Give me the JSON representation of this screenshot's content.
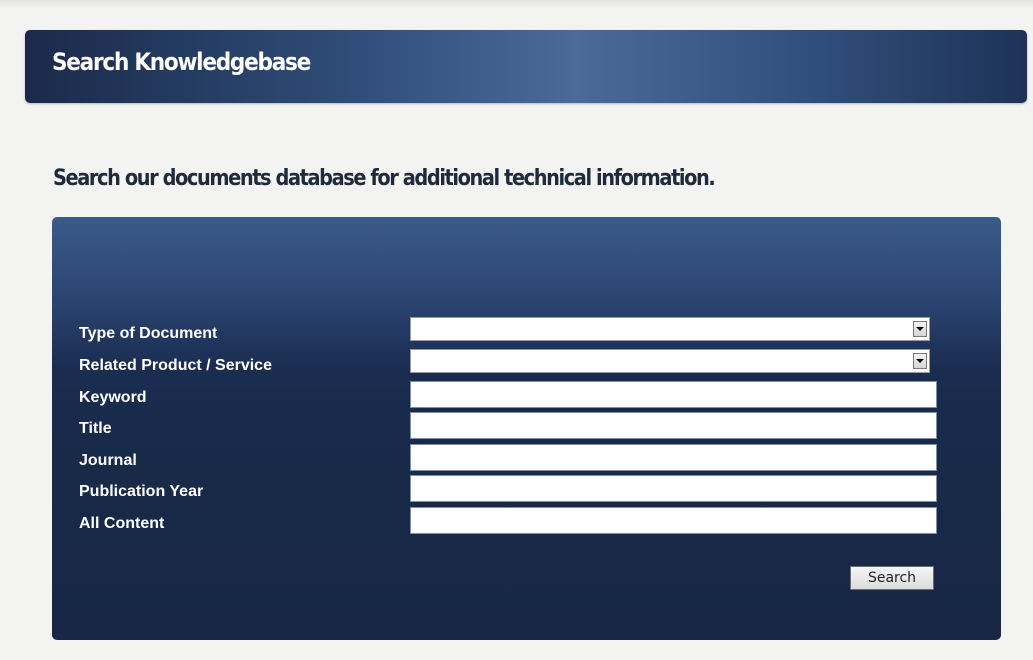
{
  "page": {
    "title": "Search Knowledgebase",
    "subheading": "Search our documents database for additional technical information."
  },
  "form": {
    "fields": [
      {
        "label": "Type of Document",
        "kind": "select",
        "value": ""
      },
      {
        "label": "Related Product / Service",
        "kind": "select",
        "value": ""
      },
      {
        "label": "Keyword",
        "kind": "text",
        "value": ""
      },
      {
        "label": "Title",
        "kind": "text",
        "value": ""
      },
      {
        "label": "Journal",
        "kind": "text",
        "value": ""
      },
      {
        "label": "Publication Year",
        "kind": "text",
        "value": ""
      },
      {
        "label": "All Content",
        "kind": "text",
        "value": ""
      }
    ],
    "search_label": "Search"
  },
  "colors": {
    "page_background": "#f3f3f1",
    "header_gradient_dark": "#1b2a4a",
    "header_gradient_light": "#4a6a98",
    "panel_dark": "#172745",
    "label_text": "#ffffff",
    "subheading_text": "#1f2a3c"
  },
  "icons": {
    "dropdown": "chevron-down-icon"
  }
}
